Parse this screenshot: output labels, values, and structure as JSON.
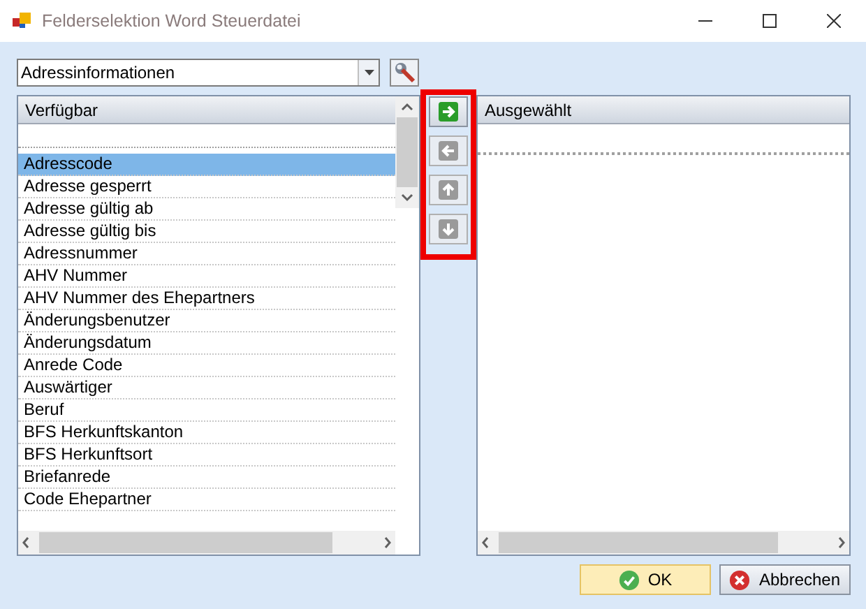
{
  "window": {
    "title": "Felderselektion Word Steuerdatei"
  },
  "category_dropdown": {
    "value": "Adressinformationen"
  },
  "available": {
    "header": "Verfügbar",
    "items": [
      {
        "label": "Adresscode",
        "selected": true
      },
      {
        "label": "Adresse gesperrt",
        "selected": false
      },
      {
        "label": "Adresse gültig ab",
        "selected": false
      },
      {
        "label": "Adresse gültig bis",
        "selected": false
      },
      {
        "label": "Adressnummer",
        "selected": false
      },
      {
        "label": "AHV Nummer",
        "selected": false
      },
      {
        "label": "AHV Nummer des Ehepartners",
        "selected": false
      },
      {
        "label": "Änderungsbenutzer",
        "selected": false
      },
      {
        "label": "Änderungsdatum",
        "selected": false
      },
      {
        "label": "Anrede Code",
        "selected": false
      },
      {
        "label": "Auswärtiger",
        "selected": false
      },
      {
        "label": "Beruf",
        "selected": false
      },
      {
        "label": "BFS Herkunftskanton",
        "selected": false
      },
      {
        "label": "BFS Herkunftsort",
        "selected": false
      },
      {
        "label": "Briefanrede",
        "selected": false
      },
      {
        "label": "Code Ehepartner",
        "selected": false
      }
    ]
  },
  "move_buttons": [
    {
      "kind": "right",
      "disabled": false
    },
    {
      "kind": "left",
      "disabled": true
    },
    {
      "kind": "up",
      "disabled": true
    },
    {
      "kind": "down",
      "disabled": true
    }
  ],
  "selected": {
    "header": "Ausgewählt"
  },
  "buttons": [
    {
      "kind": "ok",
      "label": "OK"
    },
    {
      "kind": "cancel",
      "label": "Abbrechen"
    }
  ]
}
